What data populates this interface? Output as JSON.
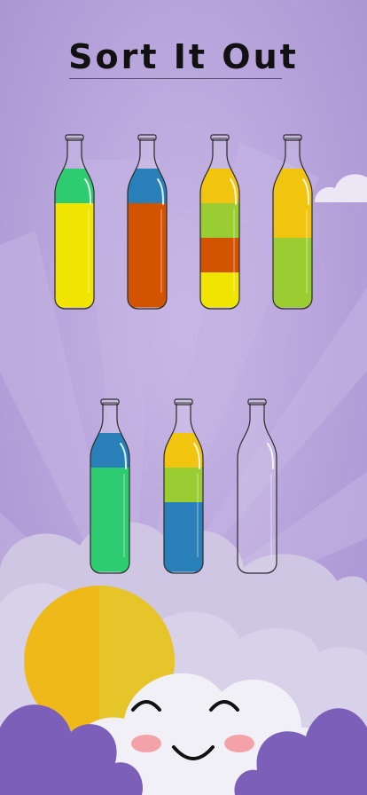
{
  "game": {
    "title": "Sort It Out"
  },
  "colors": {
    "background": "#b6a3d8",
    "green": "#2ecc71",
    "yellow": "#f0e500",
    "orange_red": "#d35400",
    "blue": "#2980b9",
    "amber": "#f1c40f",
    "lime": "#9acd32"
  },
  "bottles": [
    {
      "id": "bottle-1",
      "layers_top_to_bottom": [
        "green",
        "yellow",
        "yellow",
        "yellow"
      ]
    },
    {
      "id": "bottle-2",
      "layers_top_to_bottom": [
        "blue",
        "orange_red",
        "orange_red",
        "orange_red"
      ]
    },
    {
      "id": "bottle-3",
      "layers_top_to_bottom": [
        "amber",
        "lime",
        "orange_red",
        "yellow"
      ]
    },
    {
      "id": "bottle-4",
      "layers_top_to_bottom": [
        "amber",
        "amber",
        "lime",
        "lime"
      ]
    },
    {
      "id": "bottle-5",
      "layers_top_to_bottom": [
        "blue",
        "green",
        "green",
        "green"
      ]
    },
    {
      "id": "bottle-6",
      "layers_top_to_bottom": [
        "amber",
        "lime",
        "blue",
        "blue"
      ]
    },
    {
      "id": "bottle-7",
      "layers_top_to_bottom": []
    }
  ]
}
